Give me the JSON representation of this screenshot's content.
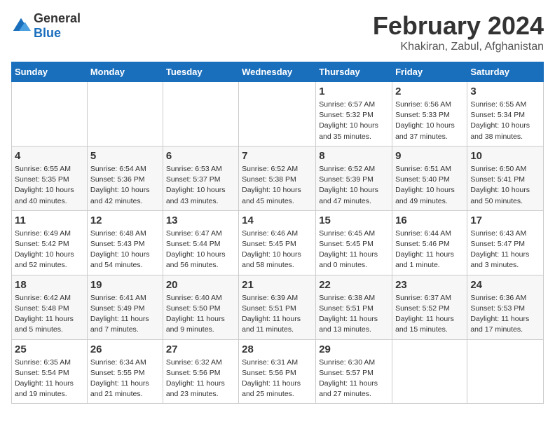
{
  "logo": {
    "general": "General",
    "blue": "Blue"
  },
  "title": "February 2024",
  "location": "Khakiran, Zabul, Afghanistan",
  "days_of_week": [
    "Sunday",
    "Monday",
    "Tuesday",
    "Wednesday",
    "Thursday",
    "Friday",
    "Saturday"
  ],
  "weeks": [
    [
      {
        "num": "",
        "info": ""
      },
      {
        "num": "",
        "info": ""
      },
      {
        "num": "",
        "info": ""
      },
      {
        "num": "",
        "info": ""
      },
      {
        "num": "1",
        "info": "Sunrise: 6:57 AM\nSunset: 5:32 PM\nDaylight: 10 hours\nand 35 minutes."
      },
      {
        "num": "2",
        "info": "Sunrise: 6:56 AM\nSunset: 5:33 PM\nDaylight: 10 hours\nand 37 minutes."
      },
      {
        "num": "3",
        "info": "Sunrise: 6:55 AM\nSunset: 5:34 PM\nDaylight: 10 hours\nand 38 minutes."
      }
    ],
    [
      {
        "num": "4",
        "info": "Sunrise: 6:55 AM\nSunset: 5:35 PM\nDaylight: 10 hours\nand 40 minutes."
      },
      {
        "num": "5",
        "info": "Sunrise: 6:54 AM\nSunset: 5:36 PM\nDaylight: 10 hours\nand 42 minutes."
      },
      {
        "num": "6",
        "info": "Sunrise: 6:53 AM\nSunset: 5:37 PM\nDaylight: 10 hours\nand 43 minutes."
      },
      {
        "num": "7",
        "info": "Sunrise: 6:52 AM\nSunset: 5:38 PM\nDaylight: 10 hours\nand 45 minutes."
      },
      {
        "num": "8",
        "info": "Sunrise: 6:52 AM\nSunset: 5:39 PM\nDaylight: 10 hours\nand 47 minutes."
      },
      {
        "num": "9",
        "info": "Sunrise: 6:51 AM\nSunset: 5:40 PM\nDaylight: 10 hours\nand 49 minutes."
      },
      {
        "num": "10",
        "info": "Sunrise: 6:50 AM\nSunset: 5:41 PM\nDaylight: 10 hours\nand 50 minutes."
      }
    ],
    [
      {
        "num": "11",
        "info": "Sunrise: 6:49 AM\nSunset: 5:42 PM\nDaylight: 10 hours\nand 52 minutes."
      },
      {
        "num": "12",
        "info": "Sunrise: 6:48 AM\nSunset: 5:43 PM\nDaylight: 10 hours\nand 54 minutes."
      },
      {
        "num": "13",
        "info": "Sunrise: 6:47 AM\nSunset: 5:44 PM\nDaylight: 10 hours\nand 56 minutes."
      },
      {
        "num": "14",
        "info": "Sunrise: 6:46 AM\nSunset: 5:45 PM\nDaylight: 10 hours\nand 58 minutes."
      },
      {
        "num": "15",
        "info": "Sunrise: 6:45 AM\nSunset: 5:45 PM\nDaylight: 11 hours\nand 0 minutes."
      },
      {
        "num": "16",
        "info": "Sunrise: 6:44 AM\nSunset: 5:46 PM\nDaylight: 11 hours\nand 1 minute."
      },
      {
        "num": "17",
        "info": "Sunrise: 6:43 AM\nSunset: 5:47 PM\nDaylight: 11 hours\nand 3 minutes."
      }
    ],
    [
      {
        "num": "18",
        "info": "Sunrise: 6:42 AM\nSunset: 5:48 PM\nDaylight: 11 hours\nand 5 minutes."
      },
      {
        "num": "19",
        "info": "Sunrise: 6:41 AM\nSunset: 5:49 PM\nDaylight: 11 hours\nand 7 minutes."
      },
      {
        "num": "20",
        "info": "Sunrise: 6:40 AM\nSunset: 5:50 PM\nDaylight: 11 hours\nand 9 minutes."
      },
      {
        "num": "21",
        "info": "Sunrise: 6:39 AM\nSunset: 5:51 PM\nDaylight: 11 hours\nand 11 minutes."
      },
      {
        "num": "22",
        "info": "Sunrise: 6:38 AM\nSunset: 5:51 PM\nDaylight: 11 hours\nand 13 minutes."
      },
      {
        "num": "23",
        "info": "Sunrise: 6:37 AM\nSunset: 5:52 PM\nDaylight: 11 hours\nand 15 minutes."
      },
      {
        "num": "24",
        "info": "Sunrise: 6:36 AM\nSunset: 5:53 PM\nDaylight: 11 hours\nand 17 minutes."
      }
    ],
    [
      {
        "num": "25",
        "info": "Sunrise: 6:35 AM\nSunset: 5:54 PM\nDaylight: 11 hours\nand 19 minutes."
      },
      {
        "num": "26",
        "info": "Sunrise: 6:34 AM\nSunset: 5:55 PM\nDaylight: 11 hours\nand 21 minutes."
      },
      {
        "num": "27",
        "info": "Sunrise: 6:32 AM\nSunset: 5:56 PM\nDaylight: 11 hours\nand 23 minutes."
      },
      {
        "num": "28",
        "info": "Sunrise: 6:31 AM\nSunset: 5:56 PM\nDaylight: 11 hours\nand 25 minutes."
      },
      {
        "num": "29",
        "info": "Sunrise: 6:30 AM\nSunset: 5:57 PM\nDaylight: 11 hours\nand 27 minutes."
      },
      {
        "num": "",
        "info": ""
      },
      {
        "num": "",
        "info": ""
      }
    ]
  ]
}
